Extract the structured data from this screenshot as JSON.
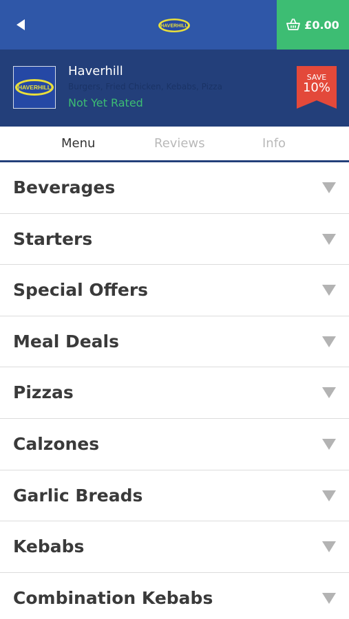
{
  "header": {
    "basket_total": "£0.00",
    "logo_text": "HAVERHILL"
  },
  "restaurant": {
    "logo_text": "HAVERHILL",
    "name": "Haverhill",
    "cuisine": "Burgers, Fried Chicken, Kebabs, Pizza",
    "rating": "Not Yet Rated",
    "save_label": "SAVE",
    "save_value": "10%"
  },
  "tabs": [
    {
      "label": "Menu",
      "active": true
    },
    {
      "label": "Reviews",
      "active": false
    },
    {
      "label": "Info",
      "active": false
    }
  ],
  "categories": [
    {
      "label": "Beverages"
    },
    {
      "label": "Starters"
    },
    {
      "label": "Special Offers"
    },
    {
      "label": "Meal Deals"
    },
    {
      "label": "Pizzas"
    },
    {
      "label": "Calzones"
    },
    {
      "label": "Garlic Breads"
    },
    {
      "label": "Kebabs"
    },
    {
      "label": "Combination Kebabs"
    }
  ],
  "colors": {
    "header_blue": "#2f57a8",
    "restaurant_blue": "#233f7a",
    "basket_green": "#3dbd73",
    "save_red": "#e3493a"
  },
  "icons": {
    "back": "back-arrow-icon",
    "basket": "basket-icon",
    "expand": "chevron-down-icon"
  }
}
